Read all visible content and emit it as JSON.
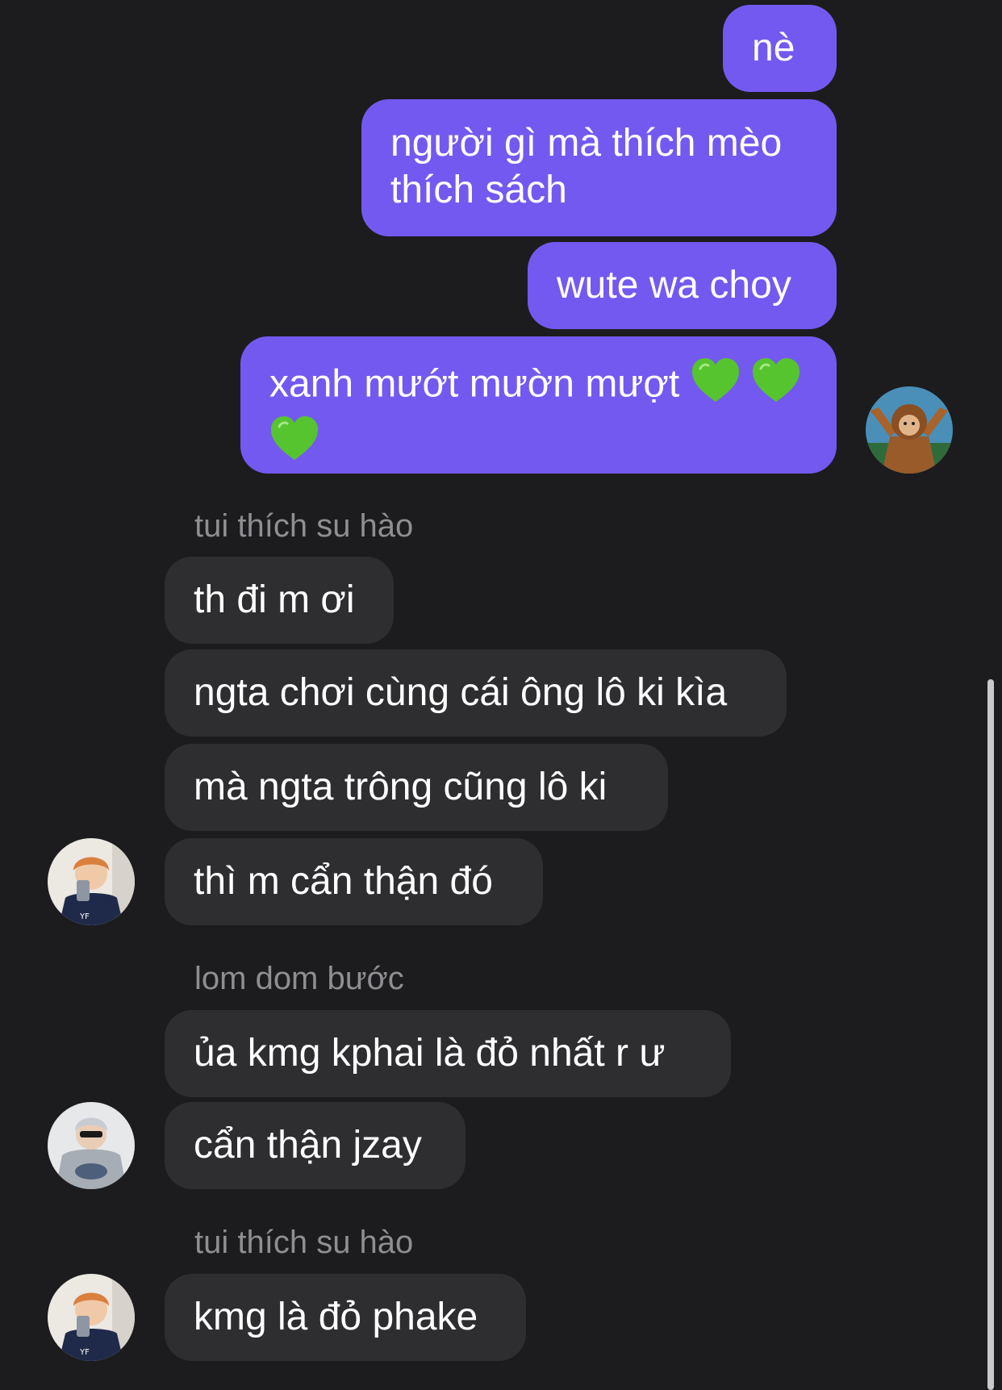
{
  "conversation": {
    "outgoing": [
      {
        "text": "nè"
      },
      {
        "line1": "người gì mà thích mèo",
        "line2": "thích sách"
      },
      {
        "text": "wute wa choy"
      },
      {
        "line1": "xanh mướt mườn mượt",
        "hearts": "💚💚💚"
      }
    ],
    "groups": [
      {
        "sender": "tui thích su hào",
        "messages": [
          "th đi m ơi",
          "ngta chơi cùng cái ông lô ki kìa",
          "mà ngta trông cũng lô ki",
          "thì m cẩn thận đó"
        ]
      },
      {
        "sender": "lom dom bước",
        "messages": [
          "ủa kmg kphai là đỏ nhất r ư",
          "cẩn thận jzay"
        ]
      },
      {
        "sender": "tui thích su hào",
        "messages": [
          "kmg là đỏ phake"
        ]
      }
    ]
  },
  "colors": {
    "background": "#1c1c1e",
    "outgoing_bubble": "#7459f0",
    "incoming_bubble": "#2e2e31",
    "sender_name": "#8e8e93",
    "heart": "#56c42e"
  },
  "icons": {
    "heart": "green-heart-emoji"
  }
}
